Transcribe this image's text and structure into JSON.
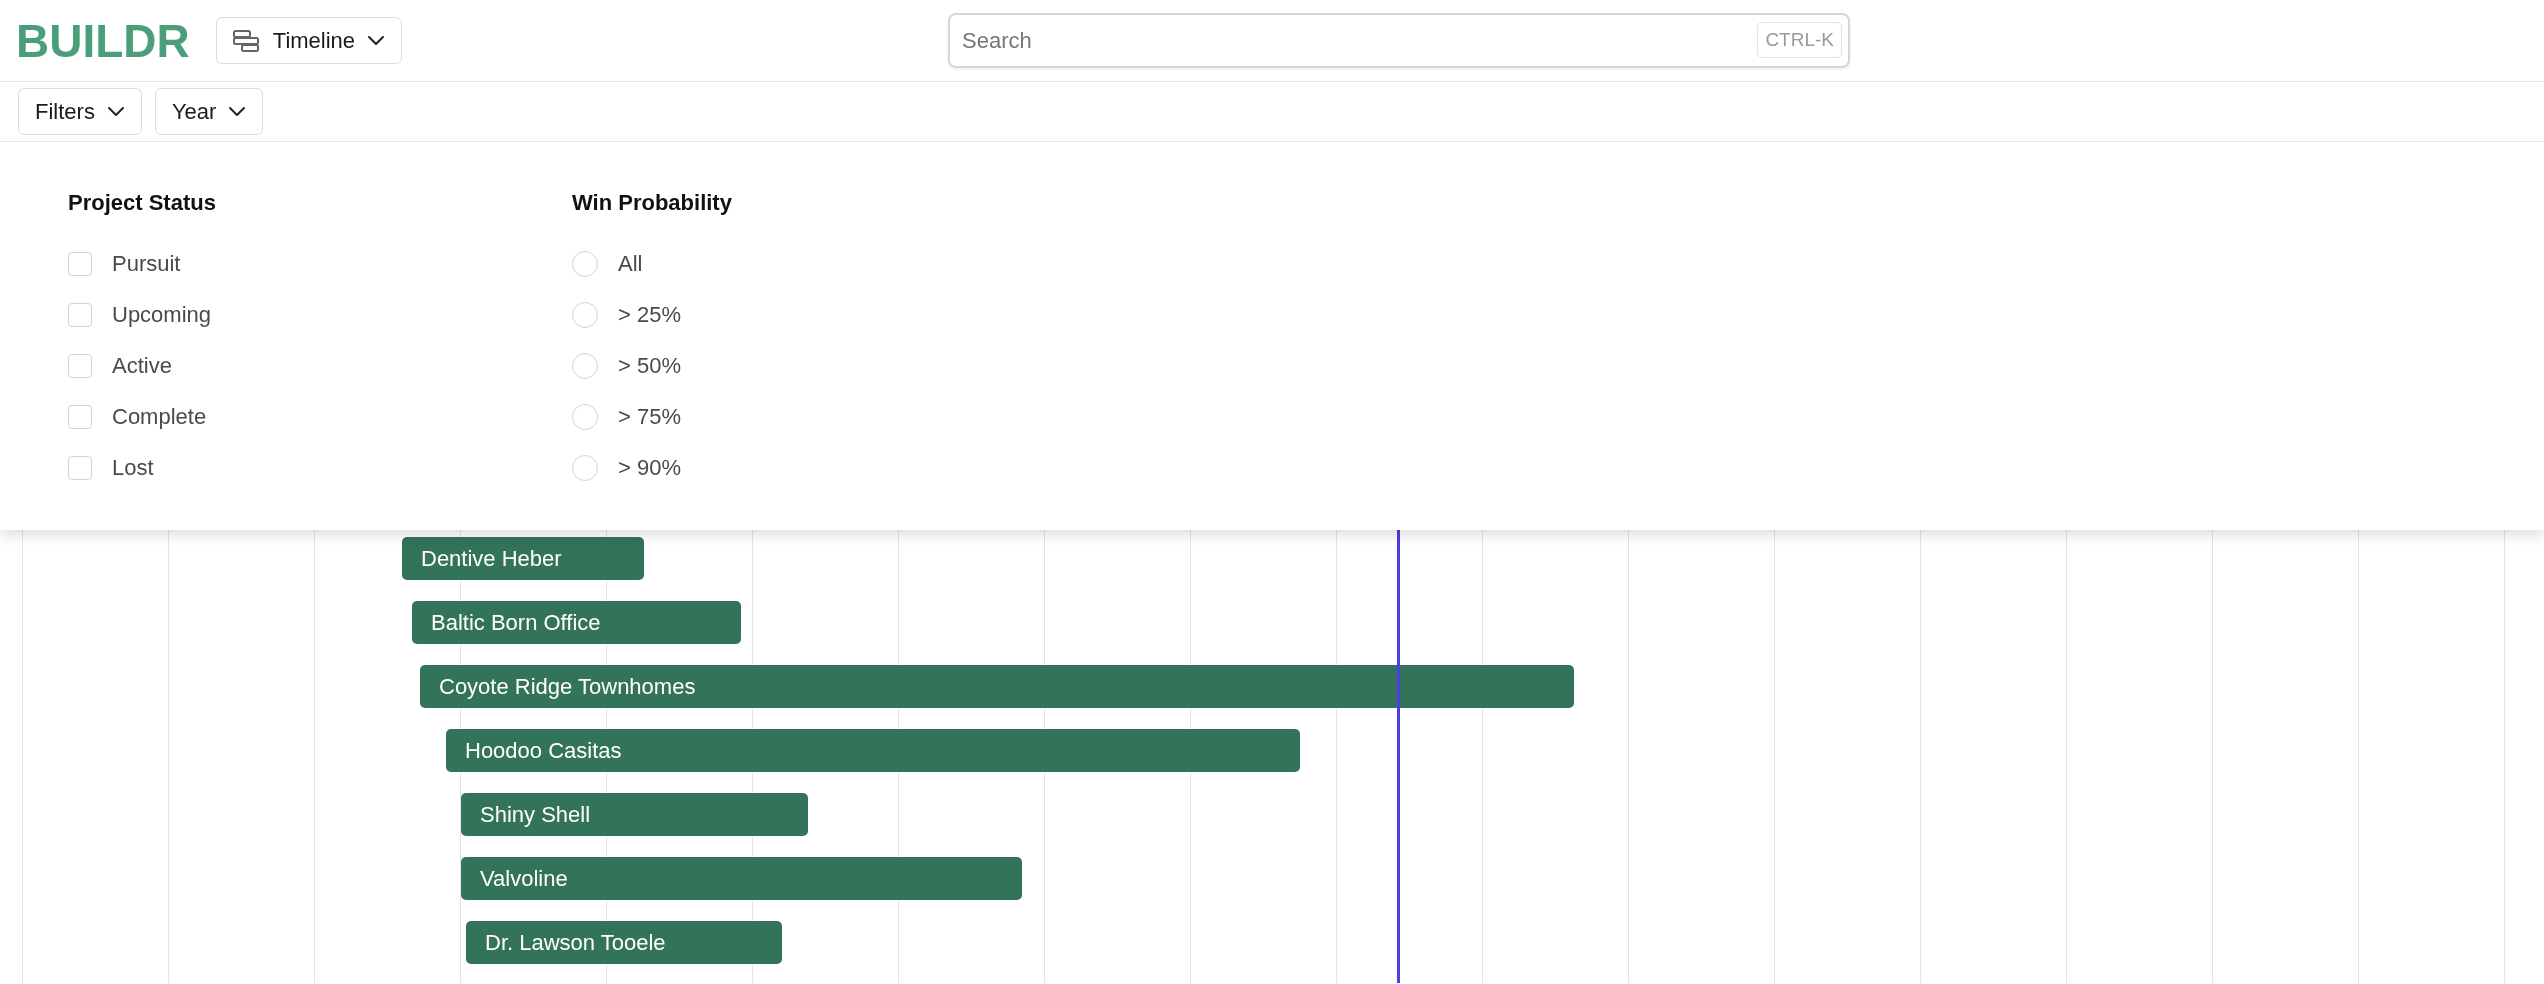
{
  "header": {
    "logo": "BUILDR",
    "view_button": {
      "label": "Timeline"
    },
    "search": {
      "placeholder": "Search",
      "shortcut": "CTRL-K"
    }
  },
  "toolbar": {
    "buttons": [
      {
        "label": "Filters"
      },
      {
        "label": "Year"
      }
    ]
  },
  "filters_panel": {
    "project_status": {
      "title": "Project Status",
      "options": [
        {
          "label": "Pursuit",
          "checked": false
        },
        {
          "label": "Upcoming",
          "checked": false
        },
        {
          "label": "Active",
          "checked": false
        },
        {
          "label": "Complete",
          "checked": false
        },
        {
          "label": "Lost",
          "checked": false
        }
      ]
    },
    "win_probability": {
      "title": "Win Probability",
      "options": [
        {
          "label": "All",
          "selected": false
        },
        {
          "label": "> 25%",
          "selected": false
        },
        {
          "label": "> 50%",
          "selected": false
        },
        {
          "label": "> 75%",
          "selected": false
        },
        {
          "label": "> 90%",
          "selected": false
        }
      ]
    }
  },
  "timeline": {
    "bars": [
      {
        "label": "Dentive Heber"
      },
      {
        "label": "Baltic Born Office"
      },
      {
        "label": "Coyote Ridge Townhomes"
      },
      {
        "label": "Hoodoo Casitas"
      },
      {
        "label": "Shiny Shell"
      },
      {
        "label": "Valvoline"
      },
      {
        "label": "Dr. Lawson Tooele"
      }
    ]
  }
}
